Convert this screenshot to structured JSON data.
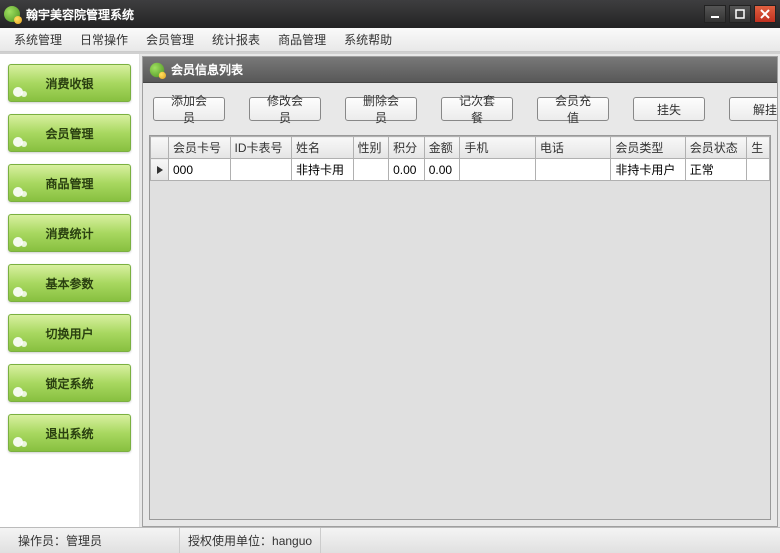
{
  "title": "翰宇美容院管理系统",
  "menubar": [
    "系统管理",
    "日常操作",
    "会员管理",
    "统计报表",
    "商品管理",
    "系统帮助"
  ],
  "sidebar": [
    {
      "label": "消费收银"
    },
    {
      "label": "会员管理"
    },
    {
      "label": "商品管理"
    },
    {
      "label": "消费统计"
    },
    {
      "label": "基本参数"
    },
    {
      "label": "切换用户"
    },
    {
      "label": "锁定系统"
    },
    {
      "label": "退出系统"
    }
  ],
  "panel": {
    "title": "会员信息列表",
    "toolbar": [
      "添加会员",
      "修改会员",
      "删除会员",
      "记次套餐",
      "会员充值",
      "挂失",
      "解挂"
    ],
    "columns": [
      "会员卡号",
      "ID卡表号",
      "姓名",
      "性别",
      "积分",
      "金额",
      "手机",
      "电话",
      "会员类型",
      "会员状态",
      "生"
    ],
    "rows": [
      {
        "card_no": "000",
        "id_no": "",
        "name": "非持卡用",
        "gender": "",
        "points": "0.00",
        "amount": "0.00",
        "mobile": "",
        "phone": "",
        "type": "非持卡用户",
        "status": "正常"
      }
    ]
  },
  "status": {
    "operator_label": "操作员：",
    "operator_value": "管理员",
    "license_label": "授权使用单位：",
    "license_value": "hanguo"
  }
}
